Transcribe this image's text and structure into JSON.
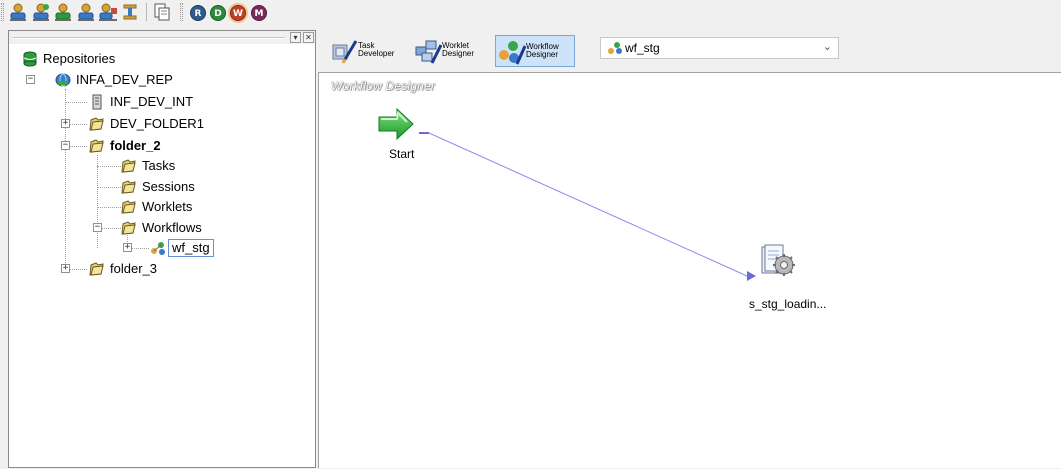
{
  "toolbar": {
    "icons": [
      "user-connect-icon",
      "user-disconnect-icon",
      "user-add-icon",
      "user-browse-icon",
      "user-group-icon",
      "table-icon",
      "copy-icon"
    ],
    "client_buttons": [
      {
        "letter": "R",
        "color": "#2d5c8c"
      },
      {
        "letter": "D",
        "color": "#2e8b3e"
      },
      {
        "letter": "W",
        "color": "#c2412a"
      },
      {
        "letter": "M",
        "color": "#7a2a5a"
      }
    ]
  },
  "navigator": {
    "root": "Repositories",
    "repo": "INFA_DEV_REP",
    "integration_service": "INF_DEV_INT",
    "folders": {
      "f1": "DEV_FOLDER1",
      "f2": "folder_2",
      "f3": "folder_3"
    },
    "subfolders": {
      "tasks": "Tasks",
      "sessions": "Sessions",
      "worklets": "Worklets",
      "workflows": "Workflows"
    },
    "selected_workflow": "wf_stg"
  },
  "designer_toolbar": {
    "task_developer": {
      "line1": "Task",
      "line2": "Developer"
    },
    "worklet_designer": {
      "line1": "Worklet",
      "line2": "Designer"
    },
    "workflow_designer": {
      "line1": "Workflow",
      "line2": "Designer"
    },
    "workflow_combo": "wf_stg"
  },
  "canvas": {
    "title": "Workflow Designer",
    "start_label": "Start",
    "session_label": "s_stg_loadin..."
  },
  "colors": {
    "link_line": "#8c8cf0",
    "start_green": "#2fb32f",
    "active_tab_bg": "#cde3f9"
  }
}
